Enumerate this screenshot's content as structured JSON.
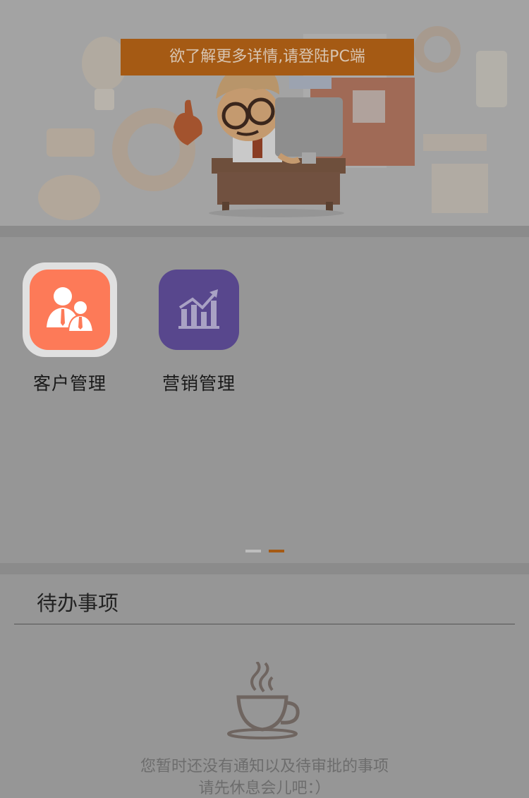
{
  "banner": {
    "notice": "欲了解更多详情,请登陆PC端",
    "accent_color": "#a55a14"
  },
  "apps": [
    {
      "label": "客户管理",
      "icon": "customer-management-icon",
      "color": "#fd7a58",
      "selected": true
    },
    {
      "label": "营销管理",
      "icon": "marketing-chart-icon",
      "color": "#58478d",
      "selected": false
    }
  ],
  "pager": {
    "page_count": 2,
    "current_page": 2,
    "active_color": "#a55a14",
    "inactive_color": "#bdbdbd"
  },
  "todo": {
    "title": "待办事项",
    "empty_icon": "coffee-cup-icon",
    "empty_line1": "您暂时还没有通知以及待审批的事项",
    "empty_line2": "请先休息会儿吧：）"
  }
}
